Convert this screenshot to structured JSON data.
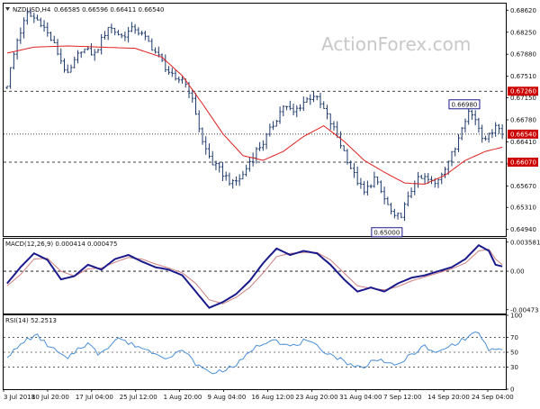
{
  "header": {
    "symbol_label": "NZDUSD,H4",
    "ohlc_label": "0.66585 0.66596 0.66411 0.66540",
    "macd_label": "MACD(12,26,9) 0.000414 0.000475",
    "rsi_label": "RSI(14) 52.2513",
    "watermark": "ActionForex.com"
  },
  "colors": {
    "candles": "#1f3a6b",
    "ma": "#e02020",
    "macd": "#1a1a8c",
    "signal": "#d08080",
    "rsi": "#4a8fd8",
    "tag_bg": "#cc0000",
    "grid": "#000000",
    "label_box": "#1a1a8c"
  },
  "chart_data": [
    {
      "type": "candlestick",
      "title": "NZDUSD,H4",
      "ylim": [
        0.6483,
        0.6873
      ],
      "yticks": [
        0.6862,
        0.6825,
        0.6788,
        0.6751,
        0.6715,
        0.6678,
        0.6641,
        0.6604,
        0.6567,
        0.6531,
        0.6494
      ],
      "xticks": [
        "3 Jul 2018",
        "10 Jul 20:00",
        "17 Jul 04:00",
        "25 Jul 12:00",
        "1 Aug 20:00",
        "9 Aug 04:00",
        "16 Aug 12:00",
        "23 Aug 20:00",
        "31 Aug 04:00",
        "7 Sep 12:00",
        "14 Sep 20:00",
        "24 Sep 04:00"
      ],
      "horizontal_lines": [
        {
          "value": 0.6726,
          "label": "0.67260",
          "style": "dashed"
        },
        {
          "value": 0.6654,
          "label": "0.66540",
          "style": "dotted"
        },
        {
          "value": 0.6607,
          "label": "0.66070",
          "style": "dashed"
        }
      ],
      "annotations": [
        {
          "label": "0.66980",
          "value": 0.6698
        },
        {
          "label": "0.65000",
          "value": 0.65
        }
      ],
      "close_anchors": [
        [
          0,
          0.6738
        ],
        [
          3,
          0.6812
        ],
        [
          6,
          0.6855
        ],
        [
          10,
          0.6842
        ],
        [
          14,
          0.6803
        ],
        [
          18,
          0.6752
        ],
        [
          22,
          0.6797
        ],
        [
          26,
          0.6788
        ],
        [
          30,
          0.6835
        ],
        [
          34,
          0.6818
        ],
        [
          38,
          0.6832
        ],
        [
          42,
          0.6808
        ],
        [
          46,
          0.6775
        ],
        [
          50,
          0.6742
        ],
        [
          52,
          0.6748
        ],
        [
          54,
          0.6728
        ],
        [
          56,
          0.669
        ],
        [
          58,
          0.664
        ],
        [
          61,
          0.6605
        ],
        [
          64,
          0.6588
        ],
        [
          67,
          0.657
        ],
        [
          70,
          0.6585
        ],
        [
          73,
          0.662
        ],
        [
          76,
          0.664
        ],
        [
          79,
          0.667
        ],
        [
          82,
          0.6702
        ],
        [
          85,
          0.669
        ],
        [
          88,
          0.6708
        ],
        [
          91,
          0.672
        ],
        [
          94,
          0.6695
        ],
        [
          97,
          0.6662
        ],
        [
          100,
          0.6625
        ],
        [
          103,
          0.6585
        ],
        [
          106,
          0.6555
        ],
        [
          109,
          0.658
        ],
        [
          112,
          0.6545
        ],
        [
          115,
          0.6512
        ],
        [
          117,
          0.652
        ],
        [
          119,
          0.6545
        ],
        [
          121,
          0.6575
        ],
        [
          124,
          0.658
        ],
        [
          127,
          0.657
        ],
        [
          130,
          0.66
        ],
        [
          133,
          0.663
        ],
        [
          135,
          0.667
        ],
        [
          137,
          0.6692
        ],
        [
          139,
          0.668
        ],
        [
          141,
          0.6652
        ],
        [
          143,
          0.665
        ],
        [
          145,
          0.6672
        ],
        [
          147,
          0.6654
        ]
      ],
      "ma_anchors": [
        [
          0,
          0.679
        ],
        [
          8,
          0.68
        ],
        [
          18,
          0.6802
        ],
        [
          28,
          0.68
        ],
        [
          38,
          0.6798
        ],
        [
          46,
          0.6783
        ],
        [
          52,
          0.6752
        ],
        [
          58,
          0.6705
        ],
        [
          64,
          0.6655
        ],
        [
          70,
          0.6618
        ],
        [
          76,
          0.661
        ],
        [
          82,
          0.6625
        ],
        [
          88,
          0.665
        ],
        [
          94,
          0.6668
        ],
        [
          100,
          0.6642
        ],
        [
          106,
          0.661
        ],
        [
          112,
          0.659
        ],
        [
          118,
          0.6572
        ],
        [
          124,
          0.657
        ],
        [
          130,
          0.6585
        ],
        [
          136,
          0.661
        ],
        [
          142,
          0.6625
        ],
        [
          147,
          0.6632
        ]
      ]
    },
    {
      "type": "line",
      "title": "MACD(12,26,9) 0.000414 0.000475",
      "ylim": [
        -0.0052,
        0.004
      ],
      "yticks": [
        0.003581,
        0.0,
        -0.00473
      ],
      "ytick_labels": [
        "0.003581",
        "0.00",
        "-0.00473"
      ],
      "zero_line": 0,
      "macd_anchors": [
        [
          0,
          -0.0015
        ],
        [
          4,
          0.0005
        ],
        [
          8,
          0.0022
        ],
        [
          12,
          0.0014
        ],
        [
          16,
          -0.001
        ],
        [
          20,
          -0.0006
        ],
        [
          24,
          0.0008
        ],
        [
          28,
          0.0002
        ],
        [
          32,
          0.0015
        ],
        [
          36,
          0.002
        ],
        [
          40,
          0.0012
        ],
        [
          44,
          0.0005
        ],
        [
          48,
          0.0002
        ],
        [
          52,
          -0.0005
        ],
        [
          56,
          -0.0025
        ],
        [
          60,
          -0.0045
        ],
        [
          64,
          -0.0038
        ],
        [
          68,
          -0.0028
        ],
        [
          72,
          -0.0012
        ],
        [
          76,
          0.001
        ],
        [
          80,
          0.0028
        ],
        [
          84,
          0.002
        ],
        [
          88,
          0.0025
        ],
        [
          92,
          0.0022
        ],
        [
          96,
          0.0008
        ],
        [
          100,
          -0.001
        ],
        [
          104,
          -0.0025
        ],
        [
          108,
          -0.002
        ],
        [
          112,
          -0.0025
        ],
        [
          116,
          -0.0015
        ],
        [
          120,
          -0.0008
        ],
        [
          124,
          -0.0005
        ],
        [
          128,
          0.0
        ],
        [
          132,
          0.0005
        ],
        [
          136,
          0.0015
        ],
        [
          140,
          0.0032
        ],
        [
          143,
          0.0025
        ],
        [
          145,
          0.0008
        ],
        [
          147,
          0.0006
        ]
      ],
      "signal_anchors": [
        [
          0,
          -0.0018
        ],
        [
          4,
          -0.0004
        ],
        [
          8,
          0.0015
        ],
        [
          12,
          0.0016
        ],
        [
          16,
          0.0
        ],
        [
          20,
          -0.0006
        ],
        [
          24,
          0.0003
        ],
        [
          28,
          0.0004
        ],
        [
          32,
          0.0011
        ],
        [
          36,
          0.0017
        ],
        [
          40,
          0.0015
        ],
        [
          44,
          0.0009
        ],
        [
          48,
          0.0004
        ],
        [
          52,
          -0.0002
        ],
        [
          56,
          -0.0015
        ],
        [
          60,
          -0.0035
        ],
        [
          64,
          -0.004
        ],
        [
          68,
          -0.0032
        ],
        [
          72,
          -0.002
        ],
        [
          76,
          -0.0002
        ],
        [
          80,
          0.0018
        ],
        [
          84,
          0.0022
        ],
        [
          88,
          0.0023
        ],
        [
          92,
          0.0023
        ],
        [
          96,
          0.0014
        ],
        [
          100,
          -0.0002
        ],
        [
          104,
          -0.0018
        ],
        [
          108,
          -0.0021
        ],
        [
          112,
          -0.0023
        ],
        [
          116,
          -0.0019
        ],
        [
          120,
          -0.0012
        ],
        [
          124,
          -0.0007
        ],
        [
          128,
          -0.0002
        ],
        [
          132,
          0.0003
        ],
        [
          136,
          0.001
        ],
        [
          140,
          0.0025
        ],
        [
          143,
          0.0027
        ],
        [
          145,
          0.0015
        ],
        [
          147,
          0.0008
        ]
      ]
    },
    {
      "type": "line",
      "title": "RSI(14) 52.2513",
      "ylim": [
        0,
        100
      ],
      "yticks": [
        100,
        70,
        50,
        30,
        0
      ],
      "levels": [
        70,
        50,
        30
      ],
      "rsi_anchors": [
        [
          0,
          45
        ],
        [
          3,
          55
        ],
        [
          6,
          68
        ],
        [
          9,
          72
        ],
        [
          12,
          60
        ],
        [
          15,
          50
        ],
        [
          18,
          40
        ],
        [
          21,
          55
        ],
        [
          24,
          62
        ],
        [
          27,
          48
        ],
        [
          30,
          58
        ],
        [
          33,
          70
        ],
        [
          36,
          62
        ],
        [
          39,
          58
        ],
        [
          42,
          52
        ],
        [
          45,
          48
        ],
        [
          48,
          42
        ],
        [
          51,
          50
        ],
        [
          53,
          52
        ],
        [
          55,
          38
        ],
        [
          58,
          28
        ],
        [
          61,
          22
        ],
        [
          64,
          26
        ],
        [
          67,
          30
        ],
        [
          70,
          40
        ],
        [
          73,
          55
        ],
        [
          76,
          62
        ],
        [
          79,
          70
        ],
        [
          82,
          60
        ],
        [
          85,
          58
        ],
        [
          88,
          65
        ],
        [
          91,
          60
        ],
        [
          94,
          52
        ],
        [
          97,
          45
        ],
        [
          100,
          38
        ],
        [
          103,
          32
        ],
        [
          106,
          28
        ],
        [
          109,
          42
        ],
        [
          112,
          38
        ],
        [
          115,
          30
        ],
        [
          118,
          40
        ],
        [
          121,
          50
        ],
        [
          124,
          58
        ],
        [
          127,
          48
        ],
        [
          130,
          55
        ],
        [
          133,
          62
        ],
        [
          136,
          68
        ],
        [
          139,
          78
        ],
        [
          141,
          70
        ],
        [
          143,
          50
        ],
        [
          145,
          55
        ],
        [
          147,
          52
        ]
      ]
    }
  ]
}
